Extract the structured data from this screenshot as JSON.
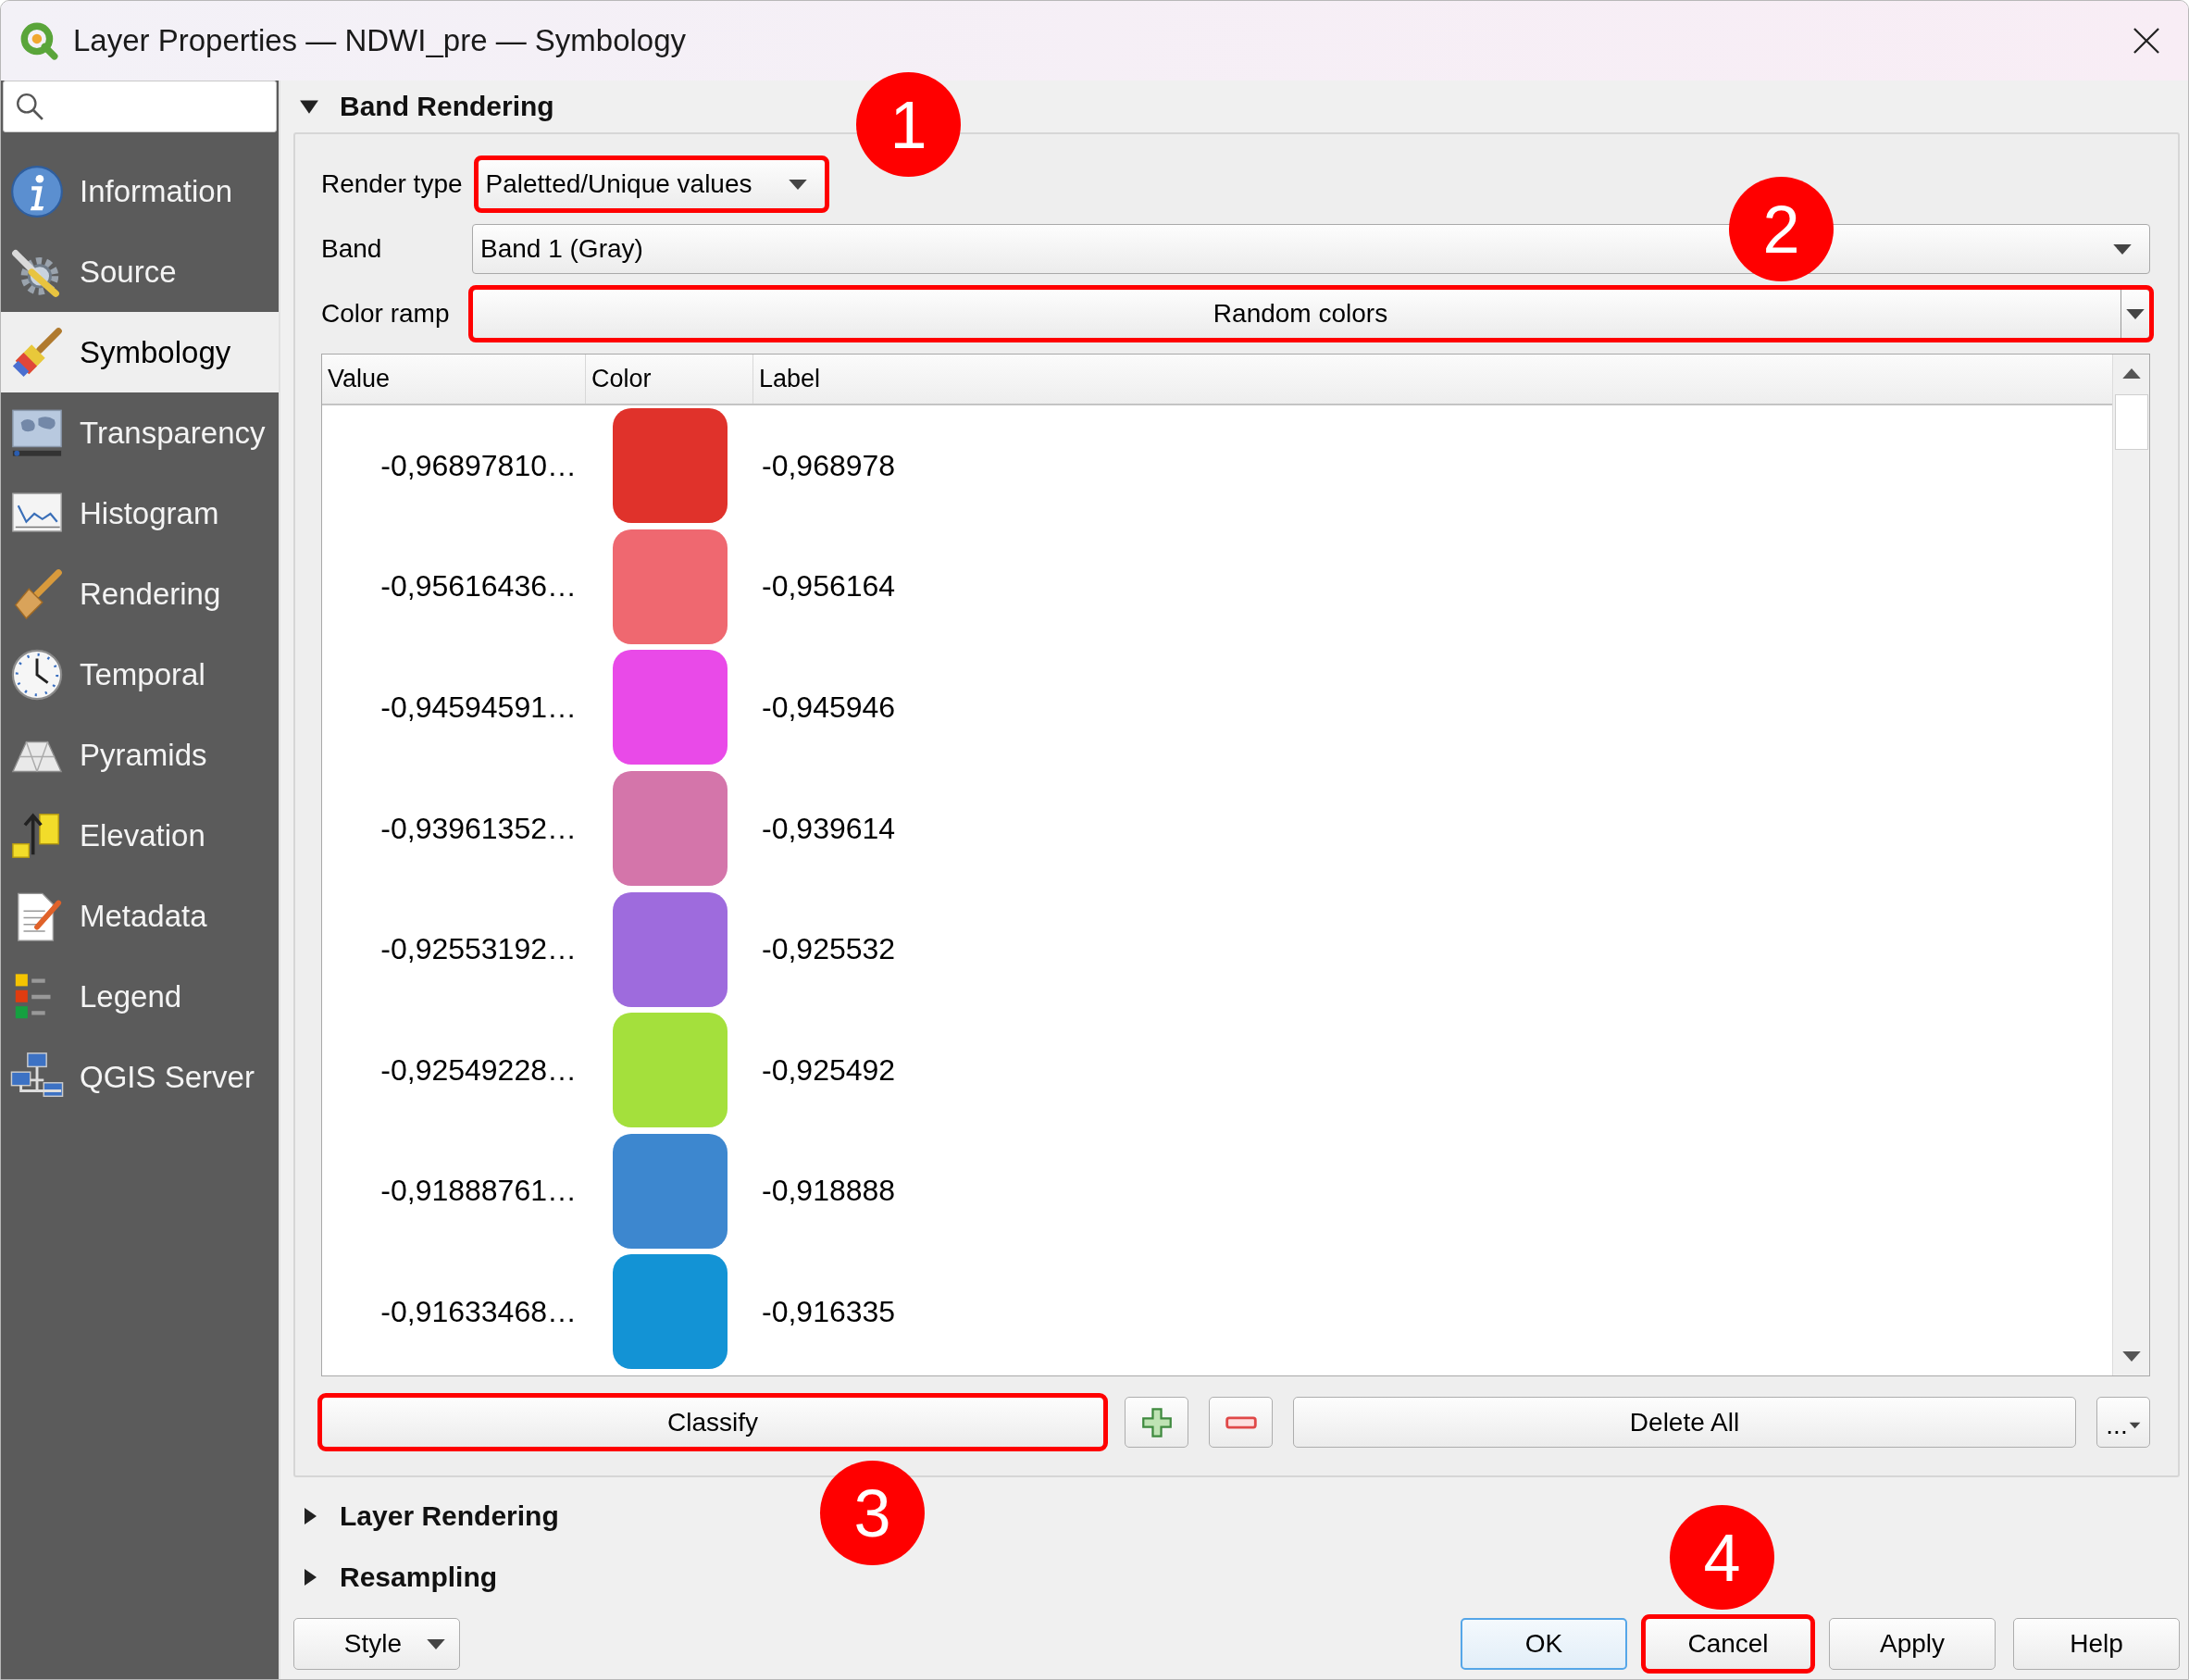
{
  "window": {
    "title": "Layer Properties — NDWI_pre — Symbology"
  },
  "sidebar": {
    "items": [
      {
        "label": "Information",
        "selected": false
      },
      {
        "label": "Source",
        "selected": false
      },
      {
        "label": "Symbology",
        "selected": true
      },
      {
        "label": "Transparency",
        "selected": false
      },
      {
        "label": "Histogram",
        "selected": false
      },
      {
        "label": "Rendering",
        "selected": false
      },
      {
        "label": "Temporal",
        "selected": false
      },
      {
        "label": "Pyramids",
        "selected": false
      },
      {
        "label": "Elevation",
        "selected": false
      },
      {
        "label": "Metadata",
        "selected": false
      },
      {
        "label": "Legend",
        "selected": false
      },
      {
        "label": "QGIS Server",
        "selected": false
      }
    ]
  },
  "band_rendering": {
    "title": "Band Rendering",
    "expanded": true,
    "render_type": {
      "label": "Render type",
      "value": "Paletted/Unique values",
      "highlighted": true
    },
    "band": {
      "label": "Band",
      "value": "Band 1 (Gray)",
      "highlighted": false
    },
    "color_ramp": {
      "label": "Color ramp",
      "value": "Random colors",
      "highlighted": true
    },
    "table": {
      "columns": [
        "Value",
        "Color",
        "Label"
      ],
      "rows": [
        {
          "value": "-0,96897810…",
          "color": "#e0322b",
          "label": "-0,968978"
        },
        {
          "value": "-0,95616436…",
          "color": "#ef6870",
          "label": "-0,956164"
        },
        {
          "value": "-0,94594591…",
          "color": "#e94ae8",
          "label": "-0,945946"
        },
        {
          "value": "-0,93961352…",
          "color": "#d475aa",
          "label": "-0,939614"
        },
        {
          "value": "-0,92553192…",
          "color": "#9e6bdd",
          "label": "-0,925532"
        },
        {
          "value": "-0,92549228…",
          "color": "#a4e03c",
          "label": "-0,925492"
        },
        {
          "value": "-0,91888761…",
          "color": "#3d87cf",
          "label": "-0,918888"
        },
        {
          "value": "-0,91633468…",
          "color": "#1393d5",
          "label": "-0,916335"
        }
      ]
    },
    "buttons": [
      {
        "kind": "text",
        "label": "Classify",
        "highlighted": true
      },
      {
        "kind": "add",
        "highlighted": false
      },
      {
        "kind": "remove",
        "highlighted": false
      },
      {
        "kind": "text",
        "label": "Delete All",
        "highlighted": false
      },
      {
        "kind": "menu",
        "label": "...",
        "highlighted": false
      }
    ]
  },
  "sections": [
    {
      "title": "Layer Rendering",
      "expanded": false
    },
    {
      "title": "Resampling",
      "expanded": false
    }
  ],
  "footer": {
    "style_button": {
      "label": "Style"
    },
    "buttons": [
      {
        "label": "OK",
        "default": true,
        "highlighted": false
      },
      {
        "label": "Cancel",
        "default": false,
        "highlighted": true
      },
      {
        "label": "Apply",
        "default": false,
        "highlighted": false
      },
      {
        "label": "Help",
        "default": false,
        "highlighted": false
      }
    ]
  },
  "annotations": [
    {
      "number": "1"
    },
    {
      "number": "2"
    },
    {
      "number": "3"
    },
    {
      "number": "4"
    }
  ]
}
